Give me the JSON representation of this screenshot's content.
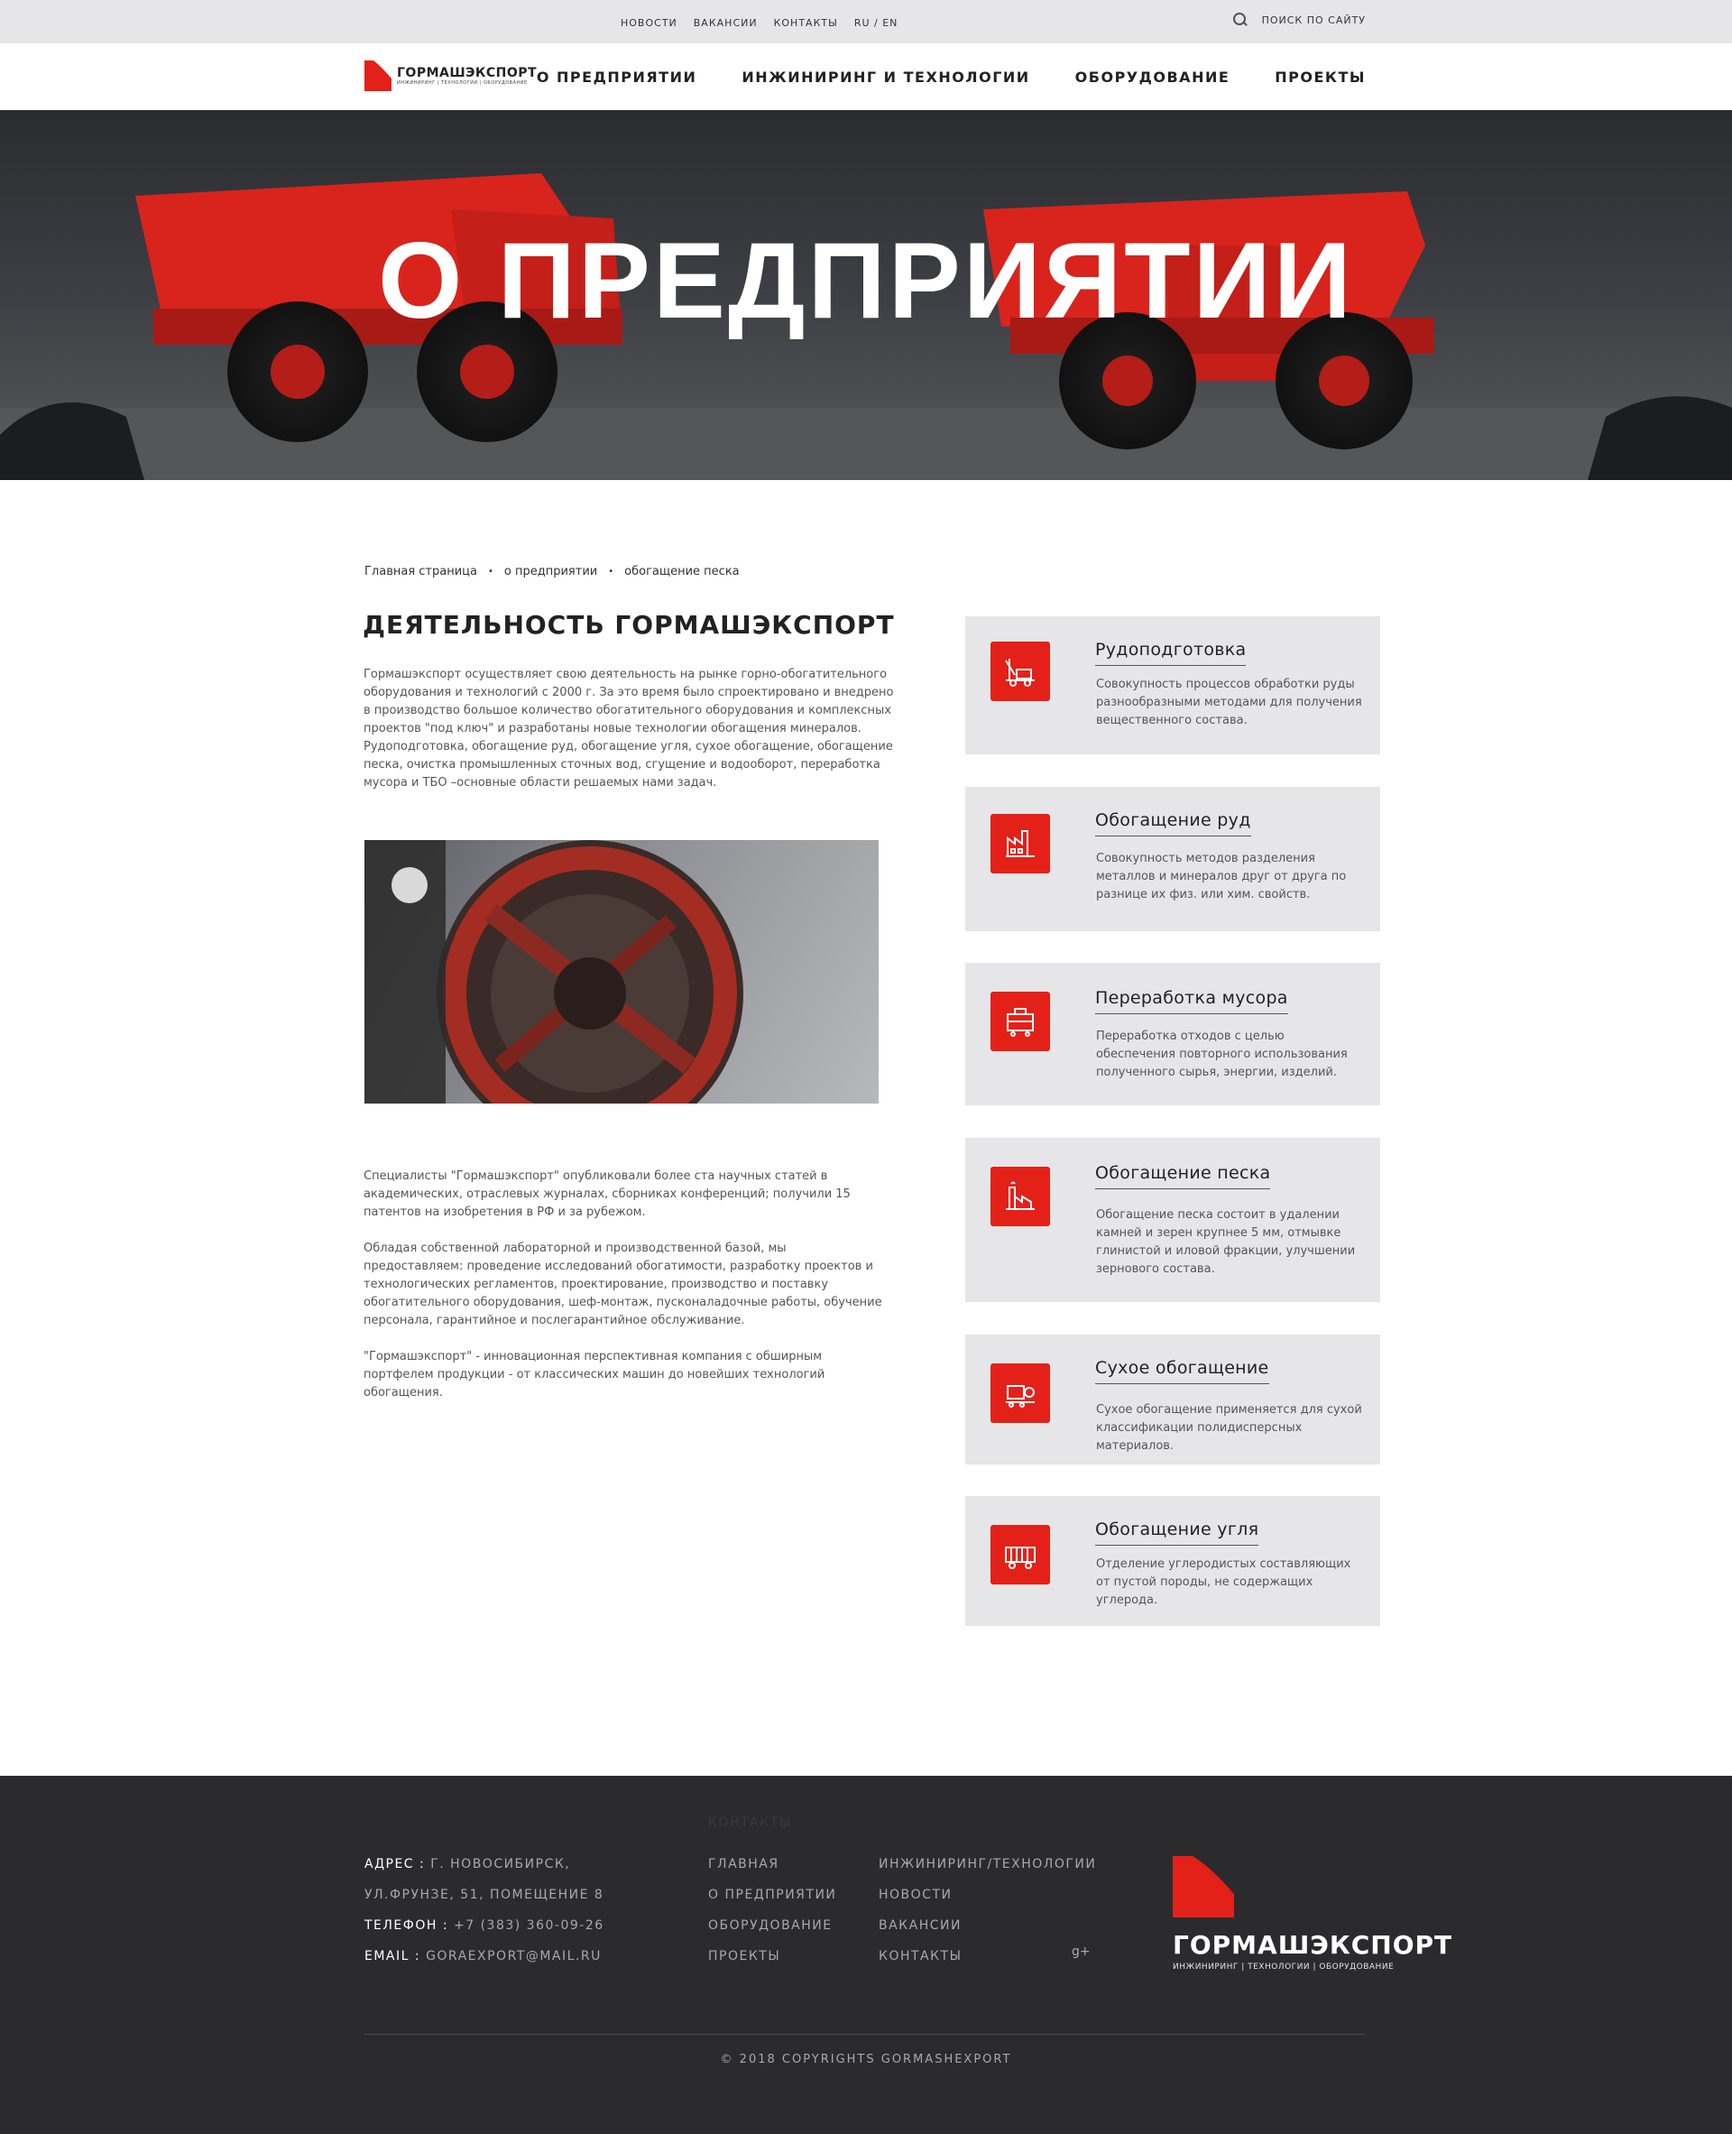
{
  "topbar": {
    "links": [
      "НОВОСТИ",
      "ВАКАНСИИ",
      "КОНТАКТЫ",
      "RU / EN"
    ],
    "search_label": "ПОИСК ПО САЙТУ"
  },
  "logo": {
    "name": "ГОРМАШЭКСПОРТ",
    "tagline": "ИНЖИНИРИНГ | ТЕХНОЛОГИИ | ОБОРУДОВАНИЕ"
  },
  "nav": [
    "О ПРЕДПРИЯТИИ",
    "ИНЖИНИРИНГ И ТЕХНОЛОГИИ",
    "ОБОРУДОВАНИЕ",
    "ПРОЕКТЫ"
  ],
  "hero": {
    "title": "О ПРЕДПРИЯТИИ"
  },
  "breadcrumb": [
    "Главная страница",
    "о предприятии",
    "обогащение песка"
  ],
  "main": {
    "heading": "ДЕЯТЕЛЬНОСТЬ ГОРМАШЭКСПОРТ",
    "intro": "Гормашэкспорт осуществляет свою деятельность на рынке горно-обогатительного оборудования и технологий с 2000 г. За это время было спроектировано и внедрено в производство большое количество обогатительного оборудования и комплексных проектов \"под ключ\" и разработаны новые технологии обогащения минералов. Рудоподготовка, обогащение руд, обогащение угля, сухое обогащение, обогащение песка, очистка промышленных сточных вод, сгущение и водооборот, переработка мусора и ТБО –основные области решаемых нами задач.",
    "para2": "Специалисты  \"Гормашэкспорт\" опубликовали более ста научных статей в академических, отраслевых журналах, сборниках конференций; получили 15 патентов на изобретения в РФ и за рубежом.",
    "para3": "Обладая собственной лабораторной и производственной базой, мы предоставляем: проведение исследований обогатимости, разработку проектов и технологических регламентов, проектирование, производство и поставку обогатительного оборудования, шеф-монтаж, пусконаладочные работы, обучение персонала, гарантийное и послегарантийное обслуживание.",
    "para4": "\"Гормашэкспорт\" - инновационная перспективная компания с обширным портфелем продукции - от классических машин до новейших технологий обогащения."
  },
  "cards": [
    {
      "title": "Рудоподготовка",
      "desc": "Совокупность процессов обработки руды разнообразными методами для получения вещественного состава.",
      "icon": "drill-rig-icon"
    },
    {
      "title": "Обогащение руд",
      "desc": "Совокупность методов разделения металлов и минералов друг от друга по разнице их физ. или хим. свойств.",
      "icon": "factory-icon"
    },
    {
      "title": "Переработка мусора",
      "desc": "Переработка отходов с целью обеспечения повторного использования полученного сырья, энергии, изделий.",
      "icon": "recycling-machine-icon"
    },
    {
      "title": "Обогащение песка",
      "desc": "Обогащение песка состоит в удалении  камней и зерен крупнее 5 мм, отмывке глинистой и иловой фракции, улучшении зернового состава.",
      "icon": "plant-chimney-icon"
    },
    {
      "title": "Сухое обогащение",
      "desc": "Сухое обогащение применяется для сухой классификации полидисперсных материалов.",
      "icon": "separator-machine-icon"
    },
    {
      "title": "Обогащение угля",
      "desc": "Отделение углеродистых составляющих от пустой породы,  не содержащих углерода.",
      "icon": "coal-wagon-icon"
    }
  ],
  "footer": {
    "address_label": "АДРЕС :",
    "address_line1": "Г. НОВОСИБИРСК,",
    "address_line2": "УЛ.ФРУНЗЕ, 51, ПОМЕЩЕНИЕ 8",
    "phone_label": "ТЕЛЕФОН :",
    "phone": "+7 (383) 360-09-26",
    "email_label": "EMAIL :",
    "email": "GORAEXPORT@MAIL.RU",
    "ghost_label": "КОНТАКТЫ",
    "col2": [
      "ГЛАВНАЯ",
      "О ПРЕДПРИЯТИИ",
      "ОБОРУДОВАНИЕ",
      "ПРОЕКТЫ"
    ],
    "col3": [
      "ИНЖИНИРИНГ/ТЕХНОЛОГИИ",
      "НОВОСТИ",
      "ВАКАНСИИ",
      "КОНТАКТЫ"
    ],
    "social": "g+",
    "logo_name": "ГОРМАШЭКСПОРТ",
    "logo_tagline": "ИНЖИНИРИНГ | ТЕХНОЛОГИИ | ОБОРУДОВАНИЕ",
    "copyright": "© 2018 COPYRIGHTS GORMASHEXPORT"
  },
  "colors": {
    "accent": "#e32119",
    "footer_bg": "#2b2b2d",
    "card_bg": "#e6e6e8",
    "topbar_bg": "#e6e6e8"
  }
}
